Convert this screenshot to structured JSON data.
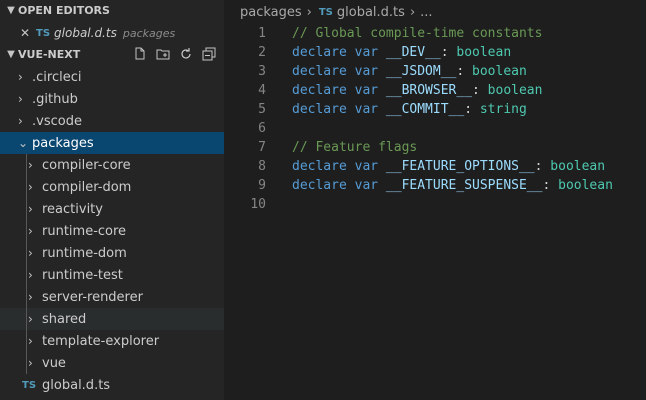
{
  "explorer": {
    "open_editors_title": "OPEN EDITORS",
    "open_editor": {
      "name": "global.d.ts",
      "path": "packages",
      "type_badge": "TS"
    },
    "project_title": "VUE-NEXT",
    "toolbar_icons": [
      "new-file-icon",
      "new-folder-icon",
      "refresh-icon",
      "collapse-all-icon"
    ],
    "root_items": [
      ".circleci",
      ".github",
      ".vscode"
    ],
    "selected_folder": "packages",
    "package_items": [
      "compiler-core",
      "compiler-dom",
      "reactivity",
      "runtime-core",
      "runtime-dom",
      "runtime-test",
      "server-renderer",
      "shared",
      "template-explorer",
      "vue"
    ],
    "file_item": {
      "name": "global.d.ts",
      "type_badge": "TS"
    }
  },
  "breadcrumb": {
    "folder": "packages",
    "type_badge": "TS",
    "file": "global.d.ts",
    "more": "..."
  },
  "code": [
    {
      "n": "1",
      "tokens": [
        {
          "t": "// Global compile-time constants",
          "c": "cm"
        }
      ]
    },
    {
      "n": "2",
      "tokens": [
        {
          "t": "declare var ",
          "c": "kw"
        },
        {
          "t": "__DEV__",
          "c": "id"
        },
        {
          "t": ": ",
          "c": "pu"
        },
        {
          "t": "boolean",
          "c": "ty"
        }
      ]
    },
    {
      "n": "3",
      "tokens": [
        {
          "t": "declare var ",
          "c": "kw"
        },
        {
          "t": "__JSDOM__",
          "c": "id"
        },
        {
          "t": ": ",
          "c": "pu"
        },
        {
          "t": "boolean",
          "c": "ty"
        }
      ]
    },
    {
      "n": "4",
      "tokens": [
        {
          "t": "declare var ",
          "c": "kw"
        },
        {
          "t": "__BROWSER__",
          "c": "id"
        },
        {
          "t": ": ",
          "c": "pu"
        },
        {
          "t": "boolean",
          "c": "ty"
        }
      ]
    },
    {
      "n": "5",
      "tokens": [
        {
          "t": "declare var ",
          "c": "kw"
        },
        {
          "t": "__COMMIT__",
          "c": "id"
        },
        {
          "t": ": ",
          "c": "pu"
        },
        {
          "t": "string",
          "c": "ty"
        }
      ]
    },
    {
      "n": "6",
      "tokens": []
    },
    {
      "n": "7",
      "tokens": [
        {
          "t": "// Feature flags",
          "c": "cm"
        }
      ]
    },
    {
      "n": "8",
      "tokens": [
        {
          "t": "declare var ",
          "c": "kw"
        },
        {
          "t": "__FEATURE_OPTIONS__",
          "c": "id"
        },
        {
          "t": ": ",
          "c": "pu"
        },
        {
          "t": "boolean",
          "c": "ty"
        }
      ]
    },
    {
      "n": "9",
      "tokens": [
        {
          "t": "declare var ",
          "c": "kw"
        },
        {
          "t": "__FEATURE_SUSPENSE__",
          "c": "id"
        },
        {
          "t": ": ",
          "c": "pu"
        },
        {
          "t": "boolean",
          "c": "ty"
        }
      ]
    },
    {
      "n": "10",
      "tokens": []
    }
  ]
}
